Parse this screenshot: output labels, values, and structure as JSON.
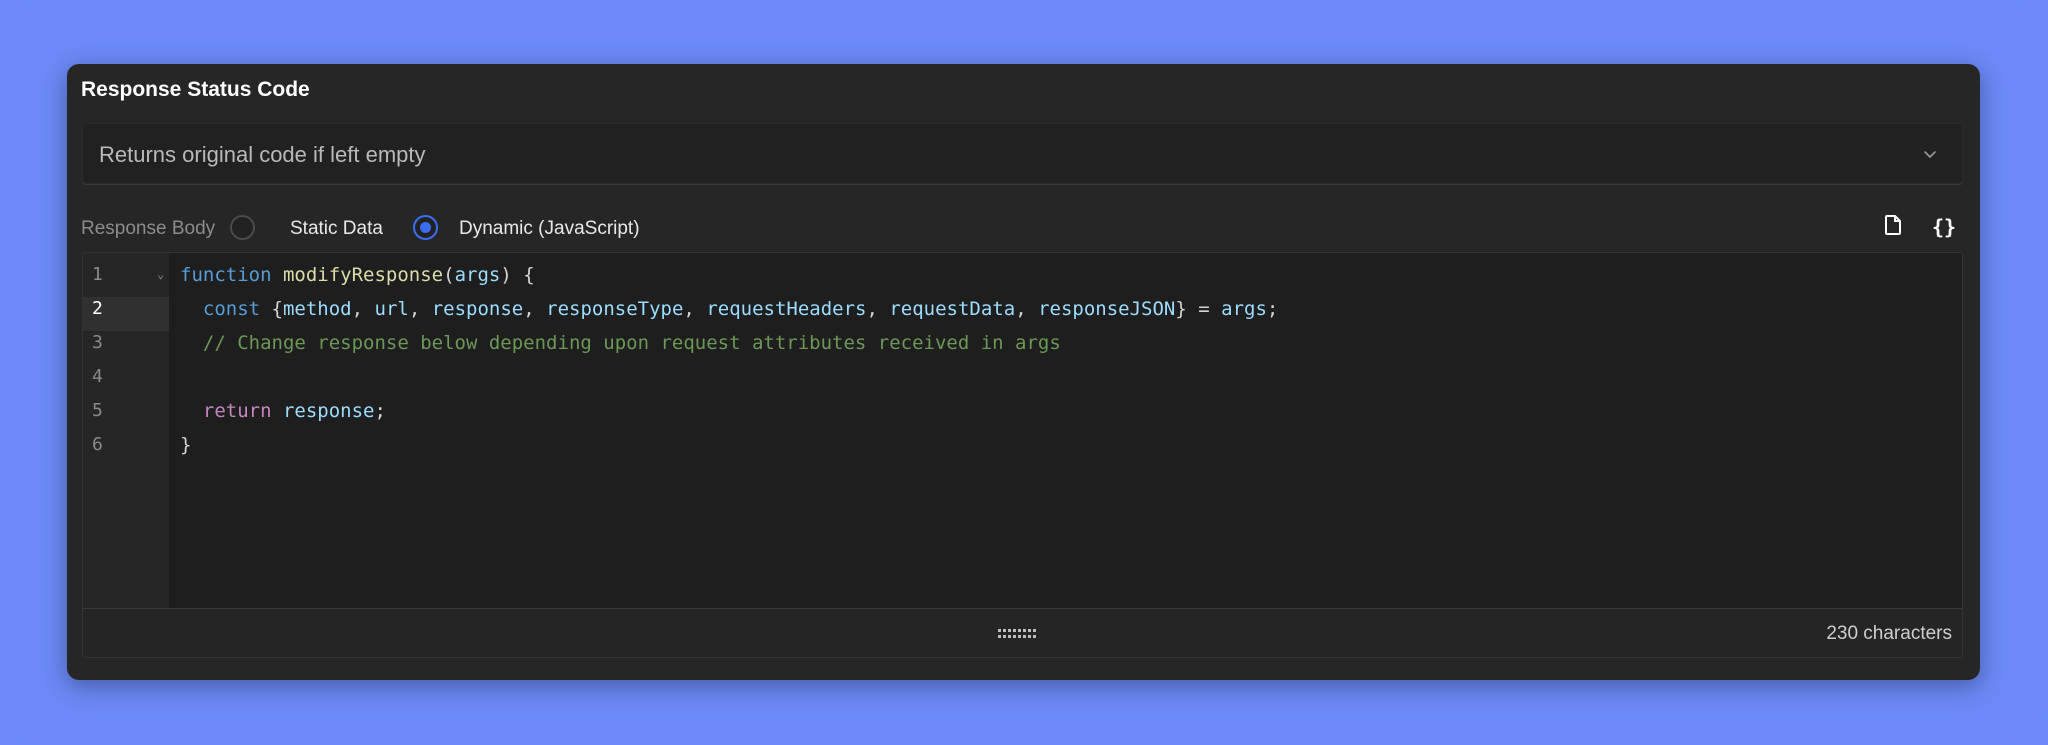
{
  "status_code": {
    "title": "Response Status Code",
    "placeholder": "Returns original code if left empty",
    "chevron_icon": "chevron-down-icon"
  },
  "response_body": {
    "label": "Response Body",
    "options": [
      {
        "label": "Static Data",
        "selected": false
      },
      {
        "label": "Dynamic (JavaScript)",
        "selected": true
      }
    ],
    "toolbar": {
      "copy_icon": "copy-icon",
      "format_label": "{}"
    }
  },
  "editor": {
    "line_numbers": [
      "1",
      "2",
      "3",
      "4",
      "5",
      "6"
    ],
    "active_line": "2",
    "lines": [
      {
        "parts": [
          [
            "kw-fn",
            "function"
          ],
          [
            "",
            " "
          ],
          [
            "fn-name",
            "modifyResponse"
          ],
          [
            "",
            "("
          ],
          [
            "param",
            "args"
          ],
          [
            "",
            ") {"
          ]
        ]
      },
      {
        "parts": [
          [
            "",
            "  "
          ],
          [
            "kw-fn",
            "const"
          ],
          [
            "",
            " {"
          ],
          [
            "param",
            "method"
          ],
          [
            "",
            ", "
          ],
          [
            "param",
            "url"
          ],
          [
            "",
            ", "
          ],
          [
            "param",
            "response"
          ],
          [
            "",
            ", "
          ],
          [
            "param",
            "responseType"
          ],
          [
            "",
            ", "
          ],
          [
            "param",
            "requestHeaders"
          ],
          [
            "",
            ", "
          ],
          [
            "param",
            "requestData"
          ],
          [
            "",
            ", "
          ],
          [
            "param",
            "responseJSON"
          ],
          [
            "",
            "} = "
          ],
          [
            "param",
            "args"
          ],
          [
            "",
            ";"
          ]
        ]
      },
      {
        "parts": [
          [
            "",
            "  "
          ],
          [
            "comment",
            "// Change response below depending upon request attributes received in args"
          ]
        ]
      },
      {
        "parts": [
          [
            "",
            ""
          ]
        ]
      },
      {
        "parts": [
          [
            "",
            "  "
          ],
          [
            "kw-ctl",
            "return"
          ],
          [
            "",
            " "
          ],
          [
            "param",
            "response"
          ],
          [
            "",
            ";"
          ]
        ]
      },
      {
        "parts": [
          [
            "",
            "}"
          ]
        ]
      }
    ],
    "char_count": "230 characters"
  },
  "colors": {
    "background": "#6b8af7",
    "card": "#262626",
    "accent": "#3b6cf6"
  }
}
